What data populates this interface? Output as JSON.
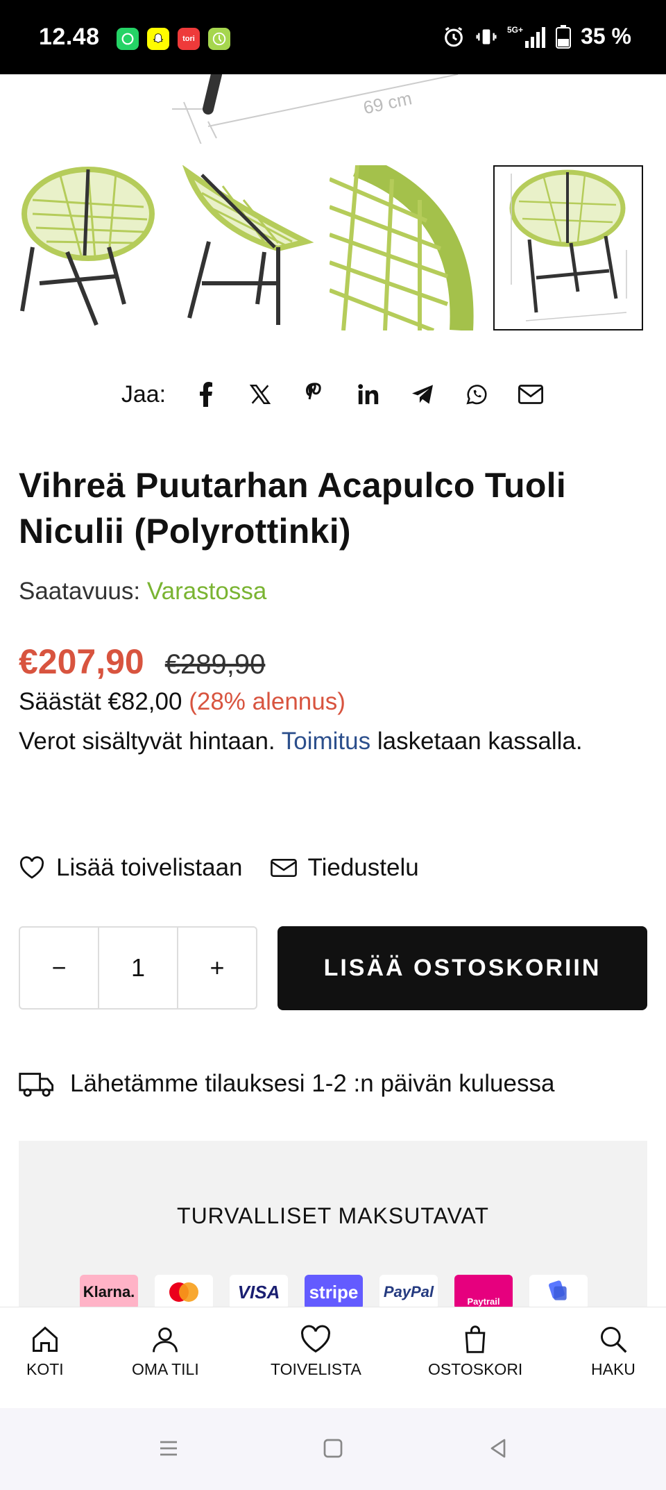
{
  "status_bar": {
    "time": "12.48",
    "apps": [
      "whatsapp-icon",
      "snapchat-icon",
      "tori-icon",
      "fitness-icon"
    ],
    "tori_label": "tori",
    "network": "5G+",
    "battery": "35 %"
  },
  "hero": {
    "dimension_label": "69 cm"
  },
  "thumbnails": {
    "count": 4,
    "selected_index": 3
  },
  "share": {
    "label": "Jaa:",
    "icons": [
      "facebook-icon",
      "x-icon",
      "pinterest-icon",
      "linkedin-icon",
      "telegram-icon",
      "whatsapp-icon",
      "email-icon"
    ]
  },
  "product": {
    "title": "Vihreä Puutarhan Acapulco Tuoli Niculii (Polyrottinki)",
    "availability_label": "Saatavuus:",
    "availability_value": "Varastossa",
    "price_now": "€207,90",
    "price_old": "€289,90",
    "save_text": "Säästät €82,00",
    "save_pct": "(28% alennus)",
    "tax_text_before": "Verot sisältyvät hintaan.",
    "tax_link": "Toimitus",
    "tax_text_after": "lasketaan kassalla."
  },
  "actions": {
    "wishlist_label": "Lisää toivelistaan",
    "inquiry_label": "Tiedustelu"
  },
  "purchase": {
    "minus": "−",
    "quantity": "1",
    "plus": "+",
    "add_to_cart": "LISÄÄ OSTOSKORIIN"
  },
  "shipping": {
    "text": "Lähetämme tilauksesi 1-2 :n päivän kuluessa"
  },
  "payments": {
    "title": "TURVALLISET MAKSUTAVAT",
    "logos": {
      "klarna": "Klarna.",
      "visa": "VISA",
      "stripe": "stripe",
      "paypal": "PayPal",
      "paytrail": "Paytrail"
    },
    "colors": {
      "klarna": "#ffb3c7",
      "stripe": "#635bff",
      "paytrail": "#e6007e",
      "visa": "#1a1f71",
      "paypal": "#253b80"
    }
  },
  "bottom_nav": {
    "items": [
      {
        "label": "KOTI",
        "icon": "home-icon"
      },
      {
        "label": "OMA TILI",
        "icon": "user-icon"
      },
      {
        "label": "TOIVELISTA",
        "icon": "heart-icon"
      },
      {
        "label": "OSTOSKORI",
        "icon": "shopping-bag-icon"
      },
      {
        "label": "HAKU",
        "icon": "search-icon"
      }
    ]
  },
  "colors": {
    "accent_red": "#d8543f",
    "stock_green": "#7ab432",
    "link_blue": "#2c4f8c",
    "chair_green": "#b5cc5a"
  }
}
